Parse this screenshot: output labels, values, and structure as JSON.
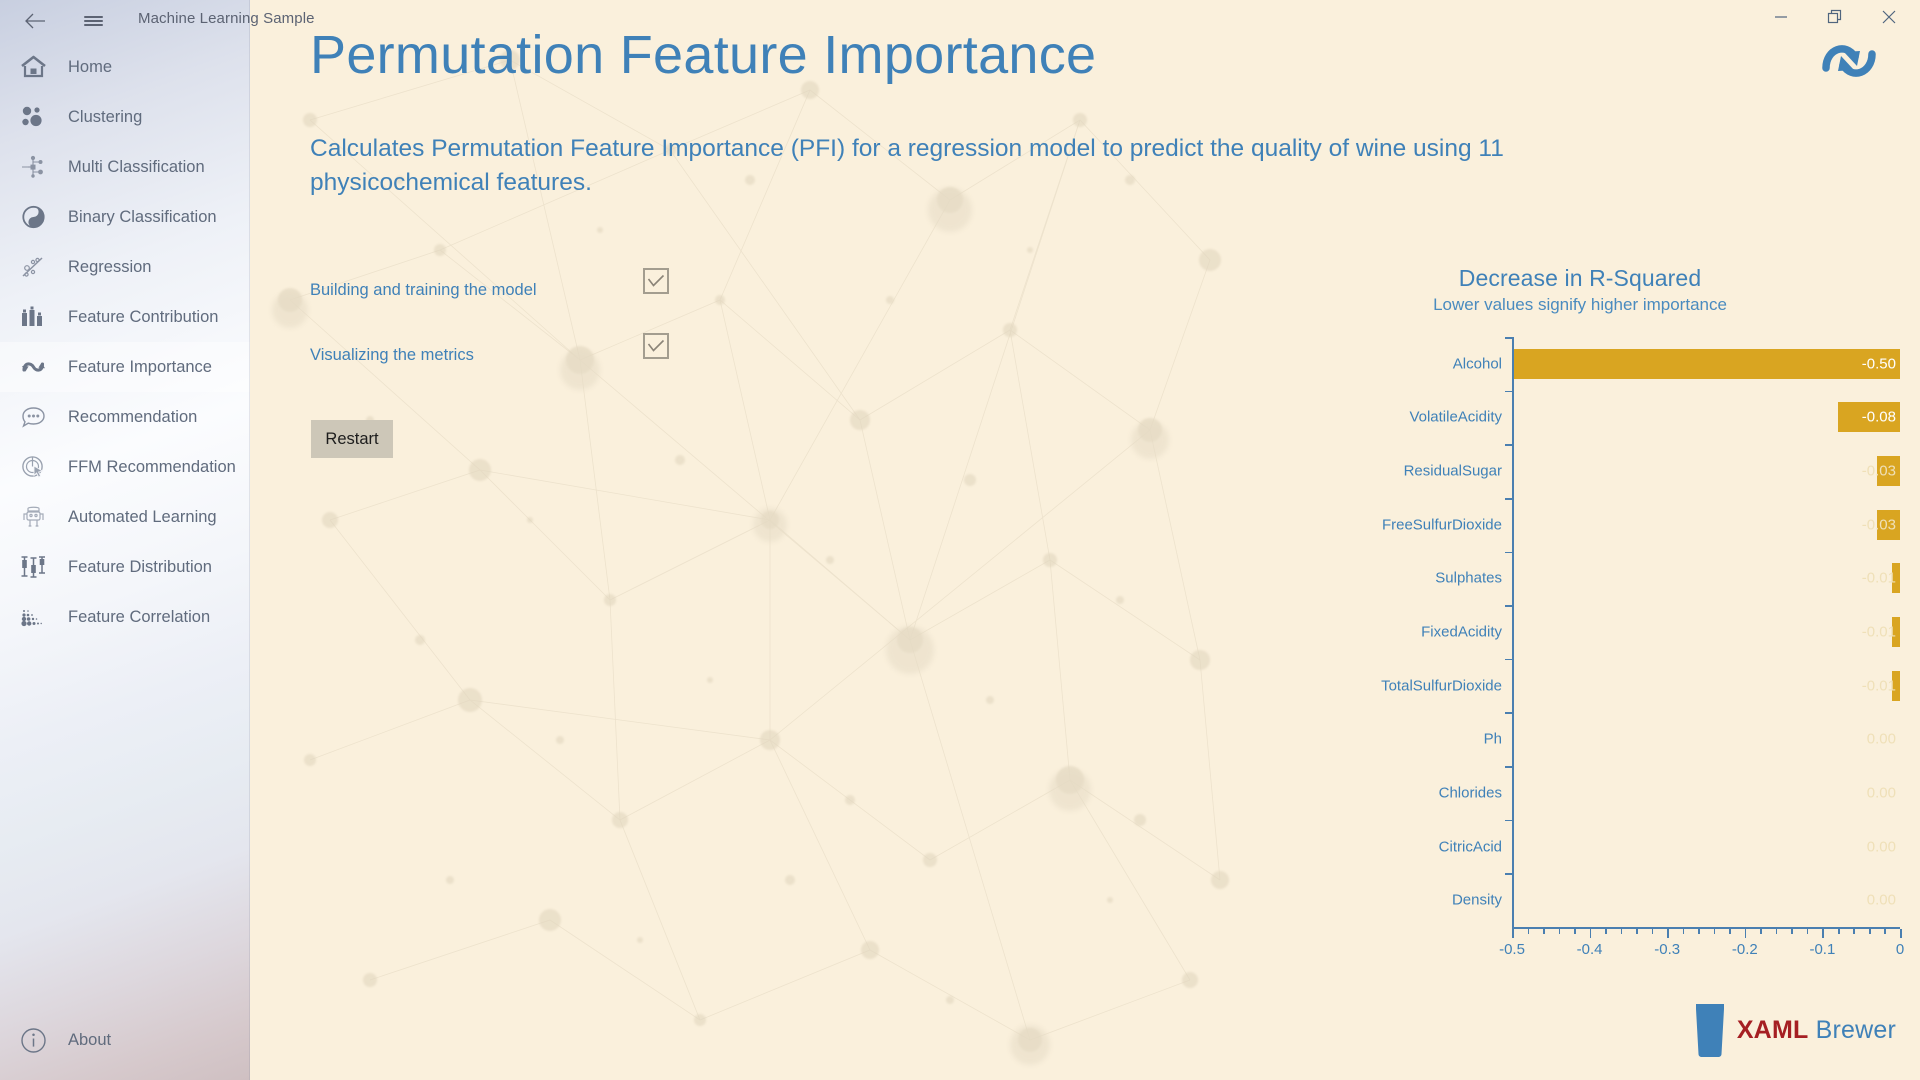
{
  "window": {
    "title": "Machine Learning Sample",
    "back_icon": "back-arrow-icon",
    "menu_icon": "hamburger-icon",
    "minimize_label": "—",
    "maximize_label": "❐",
    "close_label": "✕"
  },
  "sidebar": {
    "items": [
      {
        "label": "Home",
        "icon": "home-icon",
        "selected": false
      },
      {
        "label": "Clustering",
        "icon": "clustering-icon",
        "selected": false
      },
      {
        "label": "Multi Classification",
        "icon": "multi-classification-icon",
        "selected": false
      },
      {
        "label": "Binary Classification",
        "icon": "binary-classification-icon",
        "selected": false
      },
      {
        "label": "Regression",
        "icon": "regression-icon",
        "selected": false
      },
      {
        "label": "Feature Contribution",
        "icon": "feature-contribution-icon",
        "selected": false
      },
      {
        "label": "Feature Importance",
        "icon": "feature-importance-icon",
        "selected": true
      },
      {
        "label": "Recommendation",
        "icon": "recommendation-icon",
        "selected": false
      },
      {
        "label": "FFM Recommendation",
        "icon": "ffm-recommendation-icon",
        "selected": false
      },
      {
        "label": "Automated Learning",
        "icon": "automated-learning-icon",
        "selected": false
      },
      {
        "label": "Feature Distribution",
        "icon": "feature-distribution-icon",
        "selected": false
      },
      {
        "label": "Feature Correlation",
        "icon": "feature-correlation-icon",
        "selected": false
      }
    ],
    "about": {
      "label": "About",
      "icon": "info-icon"
    }
  },
  "main": {
    "page_title": "Permutation Feature Importance",
    "refresh_icon": "refresh-sync-icon",
    "description": "Calculates Permutation Feature Importance (PFI) for a regression model to predict the quality of wine using 11 physicochemical features.",
    "steps": [
      {
        "label": "Building and training the model",
        "checked": true
      },
      {
        "label": "Visualizing the metrics",
        "checked": true
      }
    ],
    "restart_label": "Restart"
  },
  "brand": {
    "name_bold": "XAML",
    "name_light": " Brewer",
    "glass_icon": "beer-glass-icon"
  },
  "colors": {
    "background": "#faf0dc",
    "accent_blue": "#3f81b8",
    "bar_gold": "#d9a521",
    "button_grey": "#cdc7b8",
    "brand_red": "#a51f23"
  },
  "chart_data": {
    "type": "bar",
    "orientation": "horizontal",
    "title": "Decrease in R-Squared",
    "subtitle": "Lower values signify higher importance",
    "xlabel": "",
    "ylabel": "",
    "xlim": [
      -0.5,
      0
    ],
    "xticks": [
      -0.5,
      -0.4,
      -0.3,
      -0.2,
      -0.1,
      0
    ],
    "xticklabels": [
      "-0.5",
      "-0.4",
      "-0.3",
      "-0.2",
      "-0.1",
      "0"
    ],
    "grid": false,
    "legend": false,
    "bar_color": "#d9a521",
    "categories": [
      "Alcohol",
      "VolatileAcidity",
      "ResidualSugar",
      "FreeSulfurDioxide",
      "Sulphates",
      "FixedAcidity",
      "TotalSulfurDioxide",
      "Ph",
      "Chlorides",
      "CitricAcid",
      "Density"
    ],
    "values": [
      -0.5,
      -0.08,
      -0.03,
      -0.03,
      -0.01,
      -0.01,
      -0.01,
      0.0,
      0.0,
      0.0,
      0.0
    ],
    "data_labels": [
      "-0.50",
      "-0.08",
      "-0.03",
      "-0.03",
      "-0.01",
      "-0.01",
      "-0.01",
      "0.00",
      "0.00",
      "0.00",
      "0.00"
    ]
  }
}
